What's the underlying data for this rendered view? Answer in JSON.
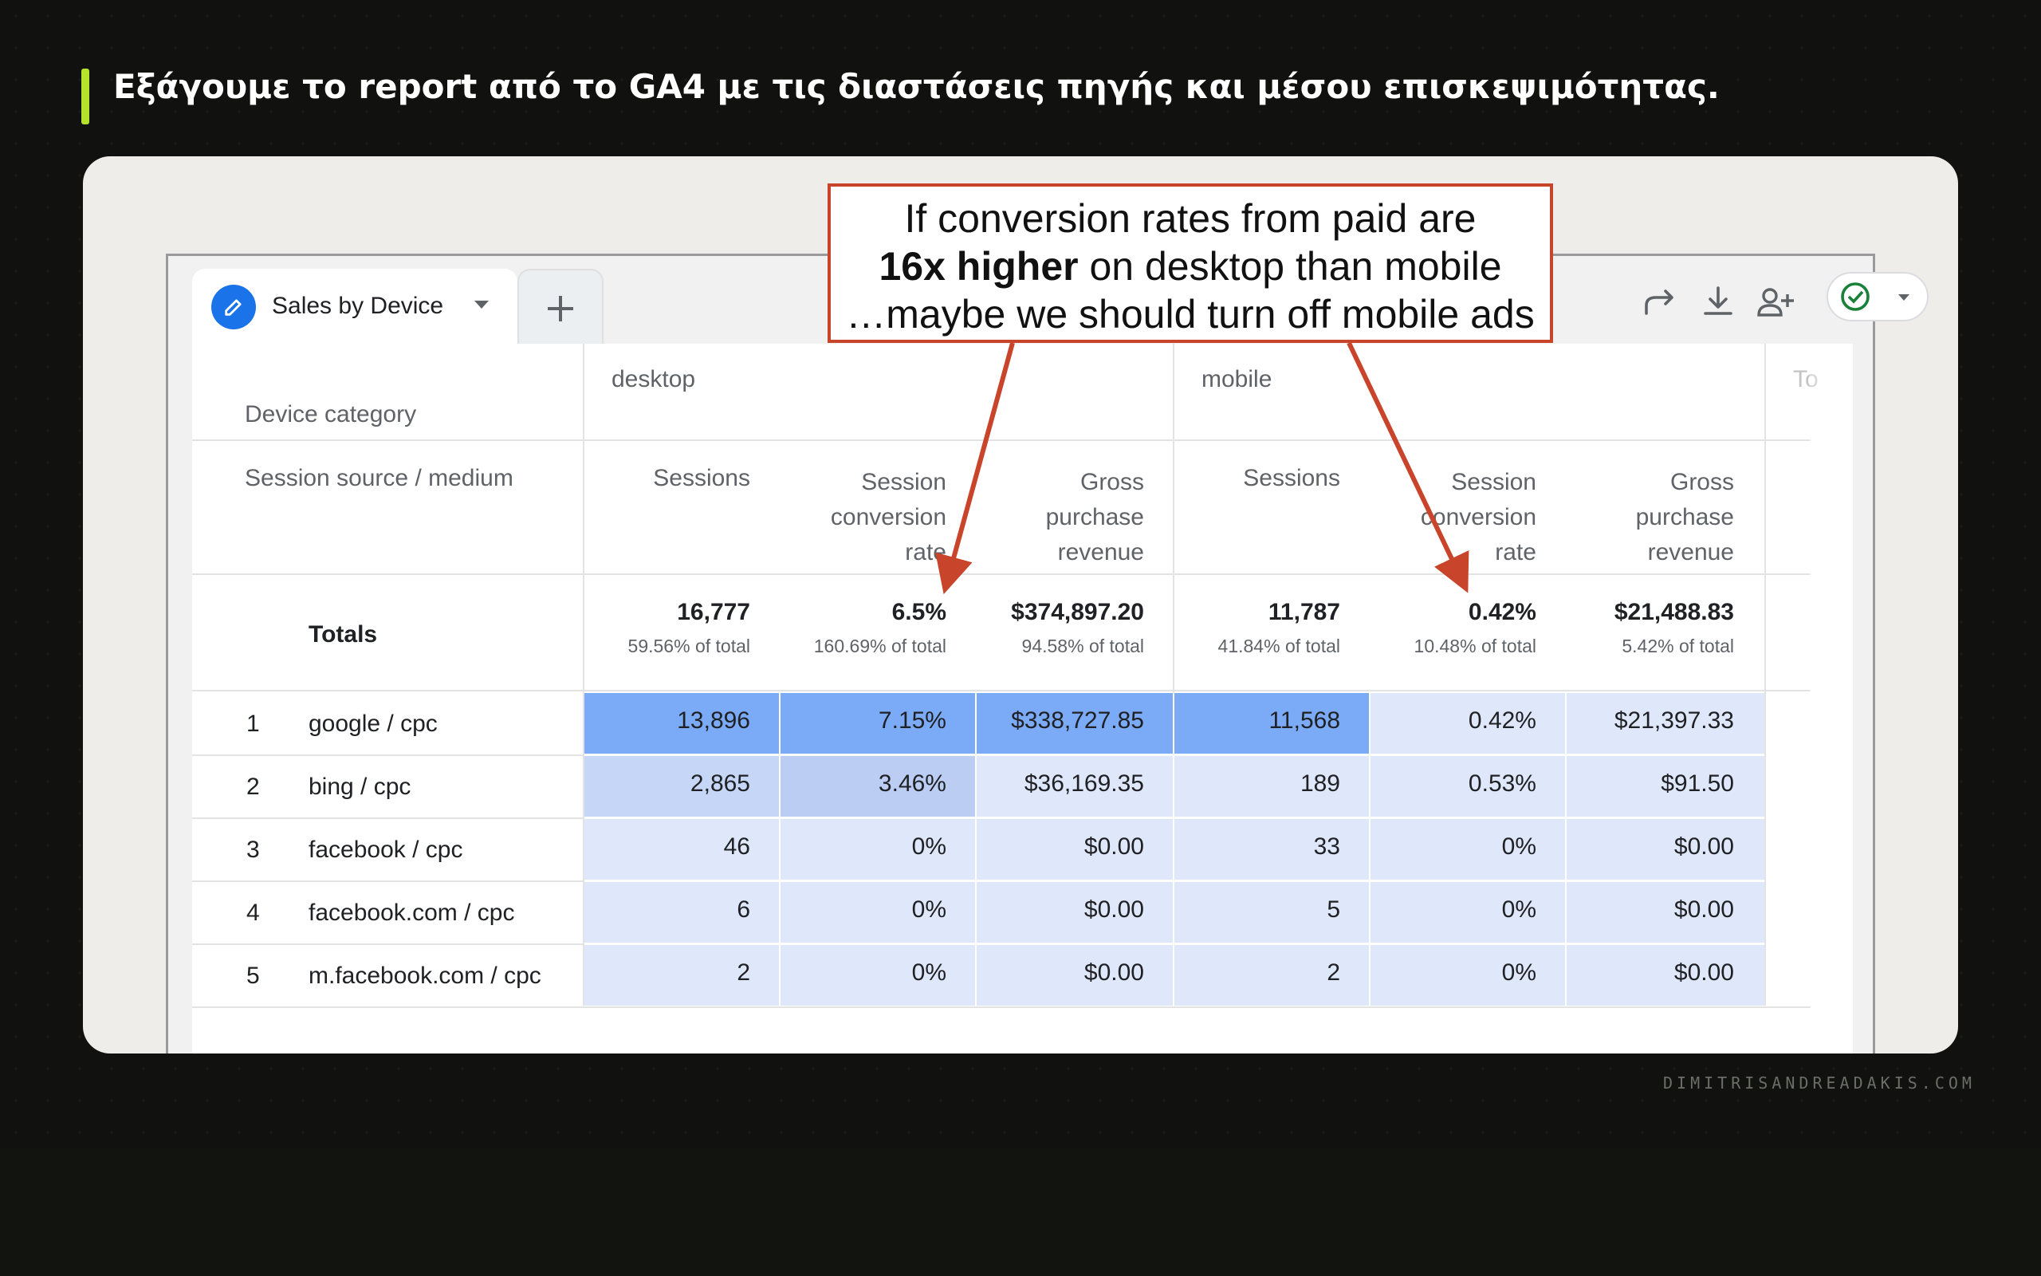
{
  "headline": "Εξάγουμε το report από το GA4 με τις διαστάσεις πηγής και μέσου επισκεψιμότητας.",
  "watermark": "DIMITRISANDREADAKIS.COM",
  "report": {
    "tab_label": "Sales by Device",
    "add_tab_icon": "plus-icon",
    "toolbar_icons": [
      "share-icon",
      "download-icon",
      "add-user-icon",
      "check-circle-icon",
      "chevron-down-icon"
    ],
    "dimension_header_1": "Device category",
    "dimension_header_2": "Session source / medium",
    "groups": [
      "desktop",
      "mobile",
      "To"
    ],
    "metric_headers": {
      "sessions": "Sessions",
      "conv_rate": [
        "Session",
        "conversion",
        "rate"
      ],
      "revenue": [
        "Gross",
        "purchase",
        "revenue"
      ]
    },
    "totals_label": "Totals",
    "totals": [
      {
        "main": "16,777",
        "sub": "59.56% of total"
      },
      {
        "main": "6.5%",
        "sub": "160.69% of total"
      },
      {
        "main": "$374,897.20",
        "sub": "94.58% of total"
      },
      {
        "main": "11,787",
        "sub": "41.84% of total"
      },
      {
        "main": "0.42%",
        "sub": "10.48% of total"
      },
      {
        "main": "$21,488.83",
        "sub": "5.42% of total"
      }
    ],
    "rows": [
      {
        "rank": "1",
        "source": "google / cpc",
        "values": [
          "13,896",
          "7.15%",
          "$338,727.85",
          "11,568",
          "0.42%",
          "$21,397.33"
        ]
      },
      {
        "rank": "2",
        "source": "bing / cpc",
        "values": [
          "2,865",
          "3.46%",
          "$36,169.35",
          "189",
          "0.53%",
          "$91.50"
        ]
      },
      {
        "rank": "3",
        "source": "facebook / cpc",
        "values": [
          "46",
          "0%",
          "$0.00",
          "33",
          "0%",
          "$0.00"
        ]
      },
      {
        "rank": "4",
        "source": "facebook.com / cpc",
        "values": [
          "6",
          "0%",
          "$0.00",
          "5",
          "0%",
          "$0.00"
        ]
      },
      {
        "rank": "5",
        "source": "m.facebook.com / cpc",
        "values": [
          "2",
          "0%",
          "$0.00",
          "2",
          "0%",
          "$0.00"
        ]
      }
    ],
    "heat_colors": {
      "strong": "#7baaf7",
      "medium": "#c6d6f7",
      "mid2": "#bccdf4",
      "light": "#dfe7fa"
    }
  },
  "callout": {
    "line1": "If conversion rates from paid are",
    "line2_bold": "16x higher",
    "line2_rest": " on desktop than mobile",
    "line3": "…maybe we should turn off mobile ads",
    "color": "#c8452c"
  }
}
